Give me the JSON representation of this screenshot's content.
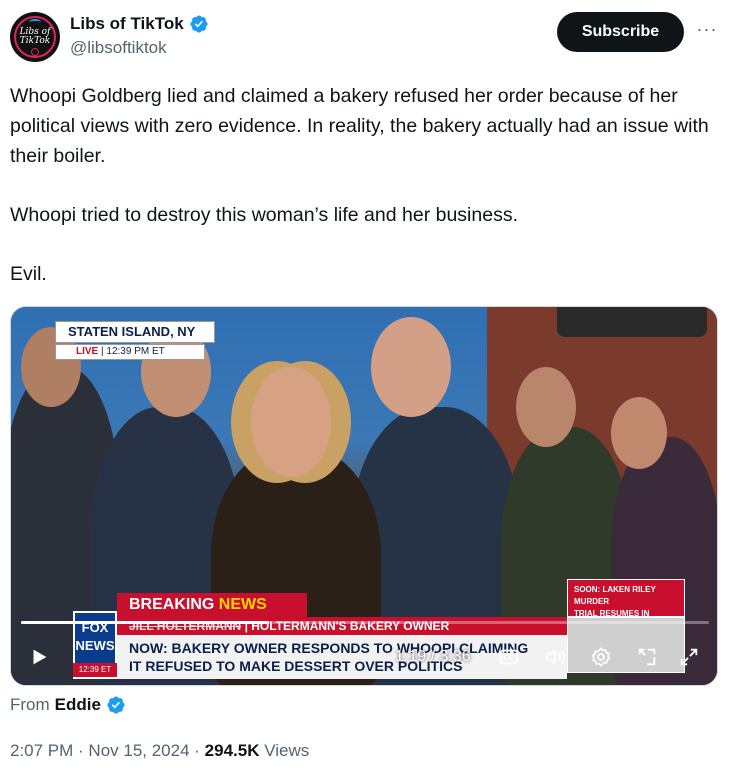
{
  "author": {
    "display_name": "Libs of TikTok",
    "handle": "@libsoftiktok",
    "avatar_text_line1": "Libs of",
    "avatar_text_line2": "TikTok",
    "verified": true,
    "verified_color": "#1d9bf0"
  },
  "actions": {
    "subscribe_label": "Subscribe",
    "more_label": "···"
  },
  "tweet": {
    "paragraph1": "Whoopi Goldberg lied and claimed a bakery refused her order because of her political views with zero evidence. In reality, the bakery actually had an issue with their boiler.",
    "paragraph2": "Whoopi tried to destroy this woman’s life  and her business.",
    "paragraph3": "Evil."
  },
  "video": {
    "location": "STATEN ISLAND, NY",
    "live_label": "LIVE",
    "live_time": "12:39 PM ET",
    "breaking_word1": "BREAKING",
    "breaking_word2": "NEWS",
    "nameplate_struck": "JILL HOLTERMANN",
    "nameplate_title": "HOLTERMANN'S BAKERY OWNER",
    "headline_line1": "NOW: BAKERY OWNER RESPONDS TO WHOOPI CLAIMING",
    "headline_line2": "IT REFUSED TO MAKE DESSERT OVER POLITICS",
    "network_line1": "FOX",
    "network_line2": "NEWS",
    "network_time": "12:39 ET",
    "soon_line1": "SOON: LAKEN RILEY MURDER",
    "soon_line2": "TRIAL RESUMES IN GEORGIA",
    "current_time": "1:19",
    "duration": "3:36",
    "time_separator": " / ",
    "progress_fraction": 0.36,
    "icons": [
      "play-icon",
      "captions-icon",
      "volume-icon",
      "settings-icon",
      "pip-icon",
      "fullscreen-icon"
    ]
  },
  "from": {
    "prefix": "From",
    "name": "Eddie",
    "verified": true
  },
  "meta": {
    "time": "2:07 PM",
    "date": "Nov 15, 2024",
    "sep": " · ",
    "views_count": "294.5K",
    "views_label": "Views"
  },
  "colors": {
    "text": "#0f1419",
    "secondary": "#536471",
    "accent": "#1d9bf0",
    "fox_red": "#c8102e",
    "fox_blue": "#0b3b8c"
  }
}
